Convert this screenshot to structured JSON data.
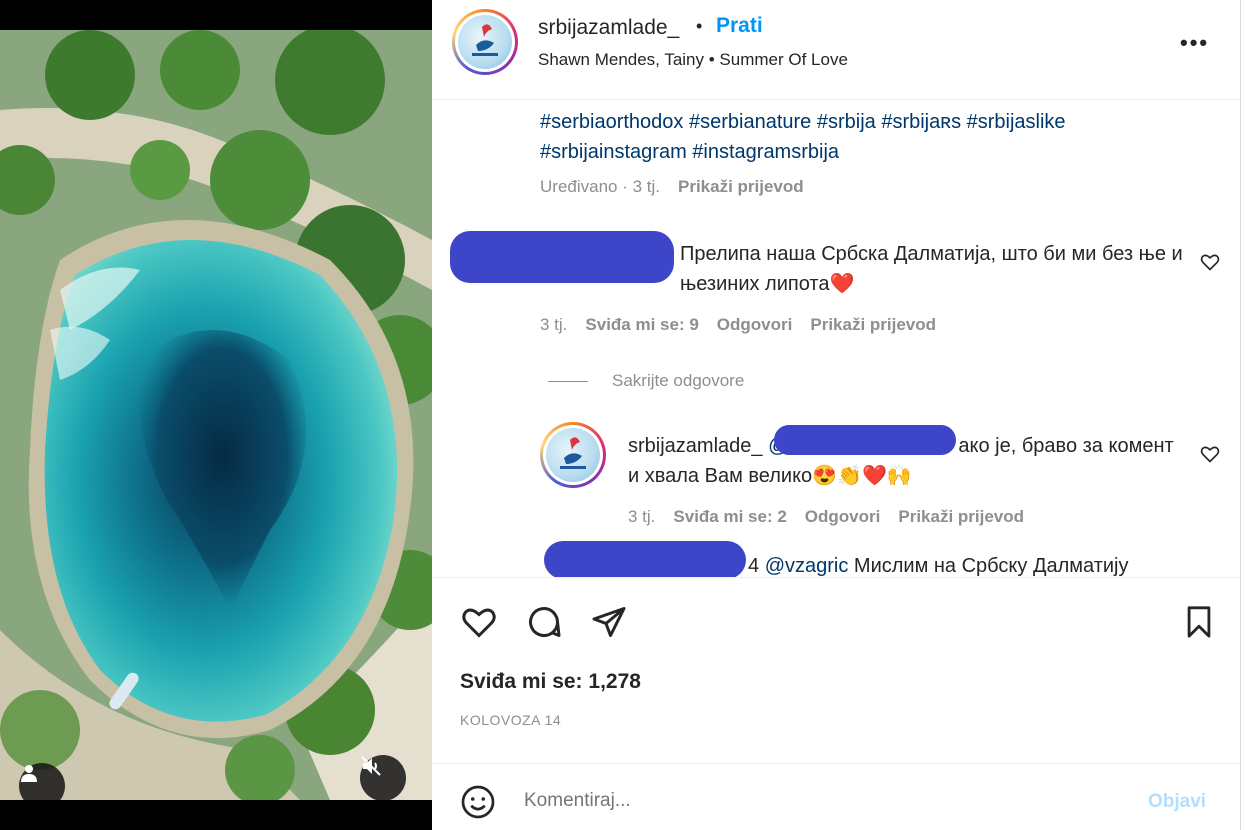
{
  "header": {
    "username": "srbijazamlade_",
    "separator": "•",
    "follow_label": "Prati",
    "audio": "Shawn Mendes, Tainy • Summer Of Love",
    "more_label": "•••"
  },
  "caption": {
    "hashtags": "#serbiaorthodox #serbianature #srbija #srbijaʀs #srbijaslike #srbijainstagram #instagramsrbija",
    "edited": "Uređivano · 3 tj.",
    "translate": "Prikaži prijevod"
  },
  "comments": [
    {
      "text": "Прелипа наша Србска Далматија, што би ми без ње и њезиних липота❤️",
      "age": "3 tj.",
      "likes": "Sviđa mi se: 9",
      "reply": "Odgovori",
      "translate": "Prikaži prijevod"
    }
  ],
  "hide_replies": "Sakrijte odgovore",
  "replies": [
    {
      "username": "srbijazamlade_",
      "text_prefix": "@",
      "text_after": "ако је, браво за комент и хвала Вам велико😍👏❤️🙌",
      "age": "3 tj.",
      "likes": "Sviđa mi se: 2",
      "reply": "Odgovori",
      "translate": "Prikaži prijevod"
    },
    {
      "suffix": "4",
      "mention": "@vzagric",
      "text": "Мислим на Србску Далматију"
    }
  ],
  "actions": {
    "likes": "Sviđa mi se: 1,278",
    "date": "KOLOVOZA 14"
  },
  "comment_box": {
    "placeholder": "Komentiraj...",
    "post_label": "Objavi"
  },
  "colors": {
    "link_blue": "#0095f6",
    "hashtag": "#00376b",
    "muted": "#8e8e8e",
    "redaction": "#3d45c8"
  },
  "icons": [
    "person-tag-icon",
    "muted-speaker-icon",
    "heart-icon",
    "comment-icon",
    "share-icon",
    "bookmark-icon",
    "emoji-icon",
    "like-comment-icon"
  ]
}
